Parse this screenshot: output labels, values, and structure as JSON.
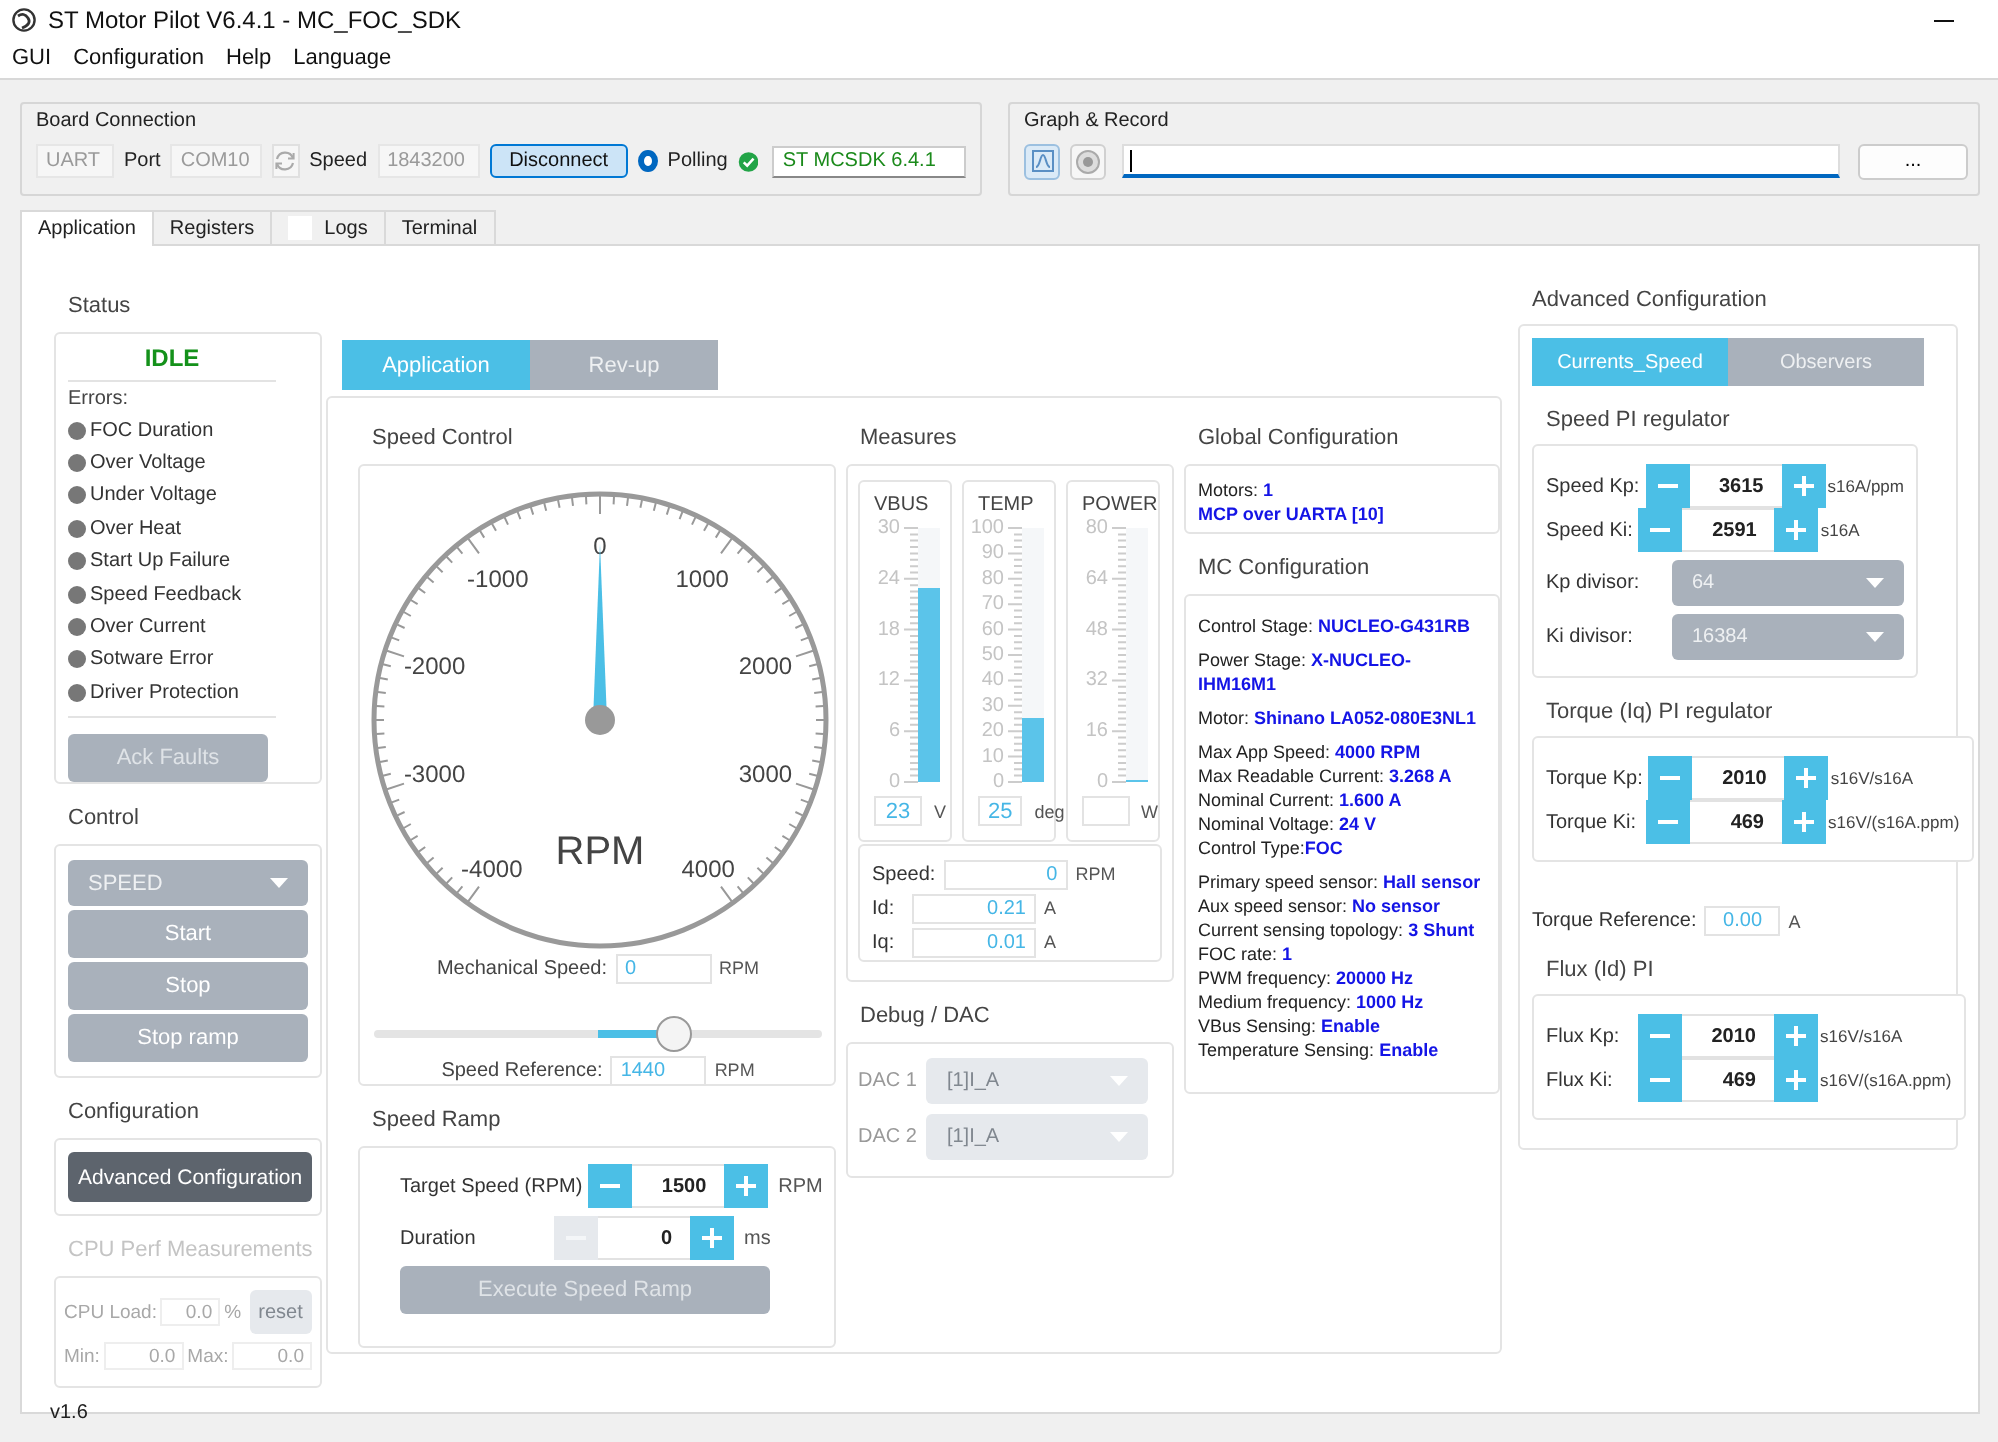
{
  "window": {
    "title": "ST Motor Pilot V6.4.1 - MC_FOC_SDK"
  },
  "menu": [
    "GUI",
    "Configuration",
    "Help",
    "Language"
  ],
  "board_connection": {
    "title": "Board Connection",
    "interface": {
      "value": "UART",
      "disabled": true
    },
    "port_label": "Port",
    "port": {
      "value": "COM10",
      "disabled": true
    },
    "speed_label": "Speed",
    "speed": {
      "value": "1843200",
      "disabled": true
    },
    "disconnect": "Disconnect",
    "polling": {
      "label": "Polling",
      "selected": true
    },
    "connected": true,
    "firmware": "ST MCSDK 6.4.1"
  },
  "graph_record": {
    "title": "Graph & Record",
    "browse": "..."
  },
  "tabs": [
    {
      "label": "Application",
      "selected": true
    },
    {
      "label": "Registers",
      "selected": false
    },
    {
      "label": "Logs",
      "selected": false
    },
    {
      "label": "Terminal",
      "selected": false
    }
  ],
  "status": {
    "title": "Status",
    "state": "IDLE",
    "errors_label": "Errors:",
    "errors": [
      {
        "label": "FOC Duration",
        "active": false
      },
      {
        "label": "Over Voltage",
        "active": false
      },
      {
        "label": "Under Voltage",
        "active": false
      },
      {
        "label": "Over Heat",
        "active": false
      },
      {
        "label": "Start Up Failure",
        "active": false
      },
      {
        "label": "Speed Feedback",
        "active": false
      },
      {
        "label": "Over Current",
        "active": false
      },
      {
        "label": "Sotware Error",
        "active": false
      },
      {
        "label": "Driver Protection",
        "active": false
      }
    ],
    "ack": {
      "label": "Ack Faults",
      "disabled": true
    }
  },
  "control": {
    "title": "Control",
    "mode": "SPEED",
    "buttons": [
      {
        "label": "Start",
        "disabled": false
      },
      {
        "label": "Stop",
        "disabled": false
      },
      {
        "label": "Stop ramp",
        "disabled": false
      }
    ]
  },
  "configuration": {
    "title": "Configuration",
    "button": "Advanced Configuration"
  },
  "cpu_perf": {
    "title": "CPU Perf Measurements",
    "disabled": true,
    "load_label": "CPU Load:",
    "load": "0.0",
    "load_unit": "%",
    "reset": "reset",
    "min_label": "Min:",
    "min": "0.0",
    "max_label": "Max:",
    "max": "0.0"
  },
  "version": "v1.6",
  "app_tabs": [
    {
      "label": "Application",
      "selected": true
    },
    {
      "label": "Rev-up",
      "selected": false
    }
  ],
  "speed_control": {
    "title": "Speed Control",
    "gauge": {
      "labels": [
        "-4000",
        "-3000",
        "-2000",
        "-1000",
        "0",
        "1000",
        "2000",
        "3000",
        "4000"
      ],
      "unit": "RPM",
      "level": 0.5
    },
    "mechanical_speed": {
      "label": "Mechanical Speed:",
      "value": "0",
      "unit": "RPM"
    },
    "slider": {
      "level": 0.67
    },
    "speed_reference": {
      "label": "Speed Reference:",
      "value": "1440",
      "unit": "RPM"
    }
  },
  "speed_ramp": {
    "title": "Speed Ramp",
    "fields": [
      {
        "label": "Target Speed (RPM)",
        "value": "1500",
        "unit": "RPM",
        "minus_disabled": false
      },
      {
        "label": "Duration",
        "value": "0",
        "unit": "ms",
        "minus_disabled": true
      }
    ],
    "execute": {
      "label": "Execute Speed Ramp",
      "disabled": true
    }
  },
  "measures": {
    "title": "Measures",
    "meters": [
      {
        "name": "VBUS",
        "ticks": [
          "30",
          "24",
          "18",
          "12",
          "6",
          "0"
        ],
        "level": 0.767,
        "value": "23",
        "unit": "V"
      },
      {
        "name": "TEMP",
        "ticks": [
          "100",
          "90",
          "80",
          "70",
          "60",
          "50",
          "40",
          "30",
          "20",
          "10",
          "0"
        ],
        "level": 0.25,
        "value": "25",
        "unit": "deg"
      },
      {
        "name": "POWER",
        "ticks": [
          "80",
          "64",
          "48",
          "32",
          "16",
          "0"
        ],
        "level": 0,
        "unit": "W"
      }
    ],
    "readings": [
      {
        "label": "Speed:",
        "value": "0",
        "unit": "RPM"
      },
      {
        "label": "Id:",
        "value": "0.21",
        "unit": "A"
      },
      {
        "label": "Iq:",
        "value": "0.01",
        "unit": "A"
      }
    ]
  },
  "debug_dac": {
    "title": "Debug / DAC",
    "disabled": true,
    "channels": [
      {
        "label": "DAC 1",
        "value": "[1]I_A"
      },
      {
        "label": "DAC 2",
        "value": "[1]I_A"
      }
    ]
  },
  "global_configuration": {
    "title": "Global Configuration",
    "lines": [
      {
        "kind": "pair",
        "text": "Motors: **1**"
      },
      {
        "kind": "value",
        "text": "MCP over UARTA [10]"
      }
    ]
  },
  "mc_configuration": {
    "title": "MC Configuration",
    "groups": [
      [
        "Control Stage: **NUCLEO-G431RB**"
      ],
      [
        "Power Stage: **X-NUCLEO-IHM16M1**"
      ],
      [
        "Motor: **Shinano LA052-080E3NL1**"
      ],
      [
        "Max App Speed: **4000 RPM**",
        "Max Readable Current: **3.268 A**",
        "Nominal Current: **1.600 A**",
        "Nominal Voltage: **24 V**",
        "Control Type:**FOC**"
      ],
      [
        "Primary speed sensor: **Hall sensor**",
        "Aux speed sensor: **No sensor**",
        "Current sensing topology: **3 Shunt**",
        "FOC rate: **1**",
        "PWM frequency: **20000 Hz**",
        "Medium frequency: **1000 Hz**",
        "VBus Sensing: **Enable**",
        "Temperature Sensing: **Enable**"
      ]
    ]
  },
  "advanced_configuration": {
    "title": "Advanced Configuration",
    "tabs": [
      {
        "label": "Currents_Speed",
        "selected": true
      },
      {
        "label": "Observers",
        "selected": false
      }
    ],
    "speed_pi": {
      "title": "Speed PI regulator",
      "gains": [
        {
          "label": "Speed Kp:",
          "value": "3615",
          "unit": "s16A/ppm"
        },
        {
          "label": "Speed Ki:",
          "value": "2591",
          "unit": "s16A"
        }
      ],
      "divisors": [
        {
          "label": "Kp divisor:",
          "value": "64"
        },
        {
          "label": "Ki divisor:",
          "value": "16384"
        }
      ]
    },
    "torque_pi": {
      "title": "Torque (Iq) PI regulator",
      "gains": [
        {
          "label": "Torque Kp:",
          "value": "2010",
          "unit": "s16V/s16A"
        },
        {
          "label": "Torque Ki:",
          "value": "469",
          "unit": "s16V/(s16A.ppm)"
        }
      ]
    },
    "torque_reference": {
      "label": "Torque Reference:",
      "value": "0.00",
      "unit": "A"
    },
    "flux_pi": {
      "title": "Flux (Id) PI",
      "gains": [
        {
          "label": "Flux Kp:",
          "value": "2010",
          "unit": "s16V/s16A"
        },
        {
          "label": "Flux Ki:",
          "value": "469",
          "unit": "s16V/(s16A.ppm)"
        }
      ]
    }
  }
}
